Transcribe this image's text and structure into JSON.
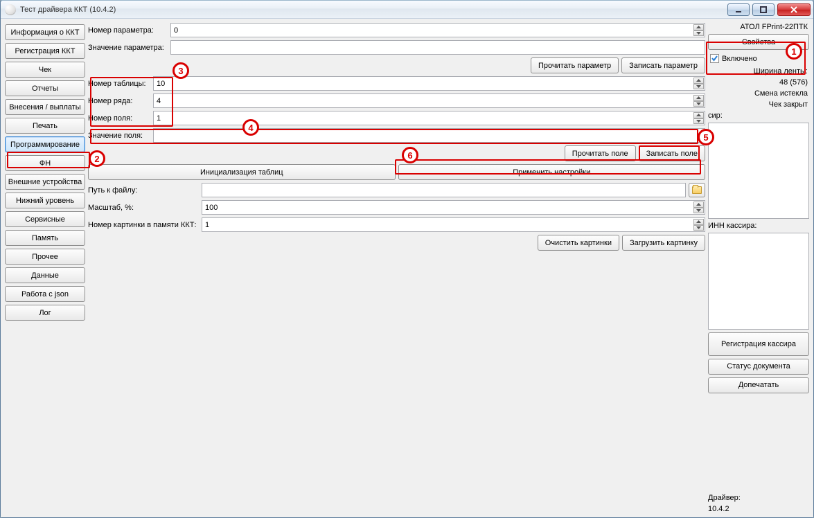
{
  "window": {
    "title": "Тест драйвера ККТ (10.4.2)"
  },
  "sidebar": {
    "items": [
      "Информация о ККТ",
      "Регистрация ККТ",
      "Чек",
      "Отчеты",
      "Внесения / выплаты",
      "Печать",
      "Программирование",
      "ФН",
      "Внешние устройства",
      "Нижний уровень",
      "Сервисные",
      "Память",
      "Прочее",
      "Данные",
      "Работа с json",
      "Лог"
    ],
    "active_index": 6
  },
  "main": {
    "param_number_label": "Номер параметра:",
    "param_number_value": "0",
    "param_value_label": "Значение параметра:",
    "param_value_value": "",
    "read_param_btn": "Прочитать параметр",
    "write_param_btn": "Записать параметр",
    "table_number_label": "Номер таблицы:",
    "table_number_value": "10",
    "row_number_label": "Номер ряда:",
    "row_number_value": "4",
    "field_number_label": "Номер поля:",
    "field_number_value": "1",
    "field_value_label": "Значение поля:",
    "field_value_value": "",
    "read_field_btn": "Прочитать поле",
    "write_field_btn": "Записать поле",
    "init_tables_btn": "Инициализация таблиц",
    "apply_settings_btn": "Применить настройки",
    "file_path_label": "Путь к файлу:",
    "file_path_value": "",
    "scale_label": "Масштаб, %:",
    "scale_value": "100",
    "pic_number_label": "Номер картинки в памяти ККТ:",
    "pic_number_value": "1",
    "clear_pics_btn": "Очистить картинки",
    "load_pic_btn": "Загрузить картинку"
  },
  "rside": {
    "device_name": "АТОЛ FPrint-22ПТК",
    "properties_btn": "Свойства",
    "enabled_label": "Включено",
    "enabled_checked": true,
    "tape_width_label": "Ширина ленты:",
    "tape_width_value": "48 (576)",
    "session_label": "Смена истекла",
    "receipt_label": "Чек закрыт",
    "cashier_trunc_label": "сир:",
    "cashier_inn_label": "ИНН кассира:",
    "register_cashier_btn": "Регистрация кассира",
    "doc_status_btn": "Статус документа",
    "reprint_btn": "Допечатать",
    "driver_label": "Драйвер:",
    "driver_version": "10.4.2"
  },
  "annotations": {
    "n1": "1",
    "n2": "2",
    "n3": "3",
    "n4": "4",
    "n5": "5",
    "n6": "6"
  }
}
